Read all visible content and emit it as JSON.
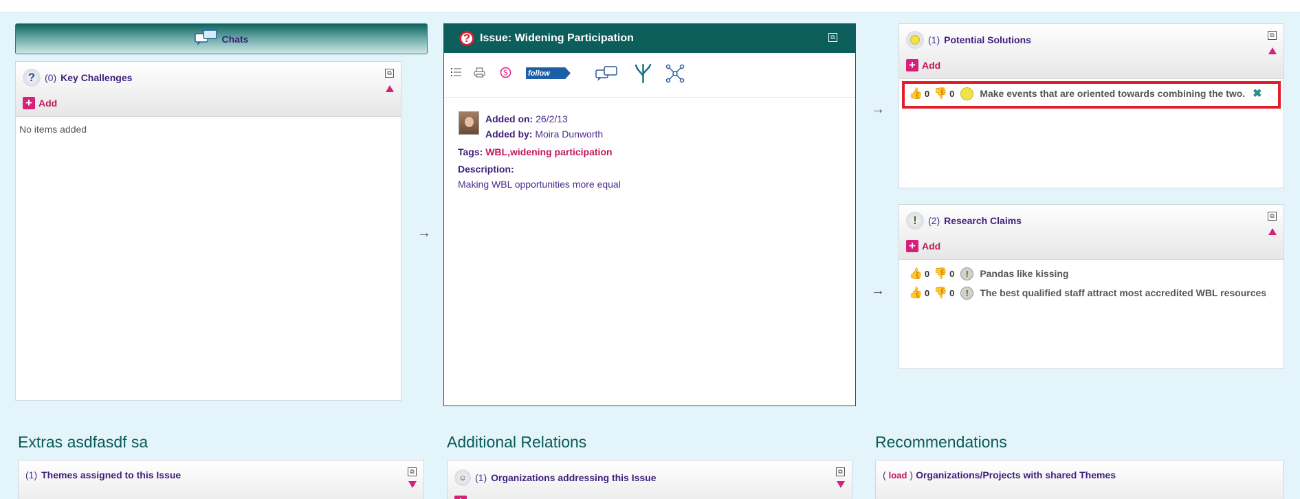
{
  "chats": {
    "label": "Chats"
  },
  "key_challenges": {
    "count": "(0)",
    "title": "Key Challenges",
    "add_label": "Add",
    "empty_text": "No items added"
  },
  "issue": {
    "title": "Issue: Widening Participation",
    "follow_label": "follow",
    "added_on_label": "Added on:",
    "added_on_value": "26/2/13",
    "added_by_label": "Added by:",
    "added_by_value": "Moira Dunworth",
    "tags_label": "Tags:",
    "tags": [
      "WBL",
      "widening participation"
    ],
    "description_label": "Description:",
    "description_value": "Making WBL opportunities more equal"
  },
  "potential_solutions": {
    "count": "(1)",
    "title": "Potential Solutions",
    "add_label": "Add",
    "items": [
      {
        "up": "0",
        "down": "0",
        "text": "Make events that are oriented towards combining the two.",
        "delete": "✖"
      }
    ]
  },
  "research_claims": {
    "count": "(2)",
    "title": "Research Claims",
    "add_label": "Add",
    "items": [
      {
        "up": "0",
        "down": "0",
        "text": "Pandas like kissing"
      },
      {
        "up": "0",
        "down": "0",
        "text": "The best qualified staff attract most accredited WBL resources"
      }
    ]
  },
  "sections": {
    "extras": {
      "title": "Extras asdfasdf sa",
      "panel_count": "(1)",
      "panel_title": "Themes assigned to this Issue"
    },
    "additional": {
      "title": "Additional Relations",
      "panel_count": "(1)",
      "panel_title": "Organizations addressing this Issue"
    },
    "recommendations": {
      "title": "Recommendations",
      "load_open": "(",
      "load_label": "load",
      "load_close": ")",
      "panel_title": "Organizations/Projects with shared Themes"
    }
  },
  "colors": {
    "accent_pink": "#d6207a",
    "teal": "#0b5e5a",
    "purple": "#3d1f7a",
    "highlight": "#e21d2c"
  }
}
